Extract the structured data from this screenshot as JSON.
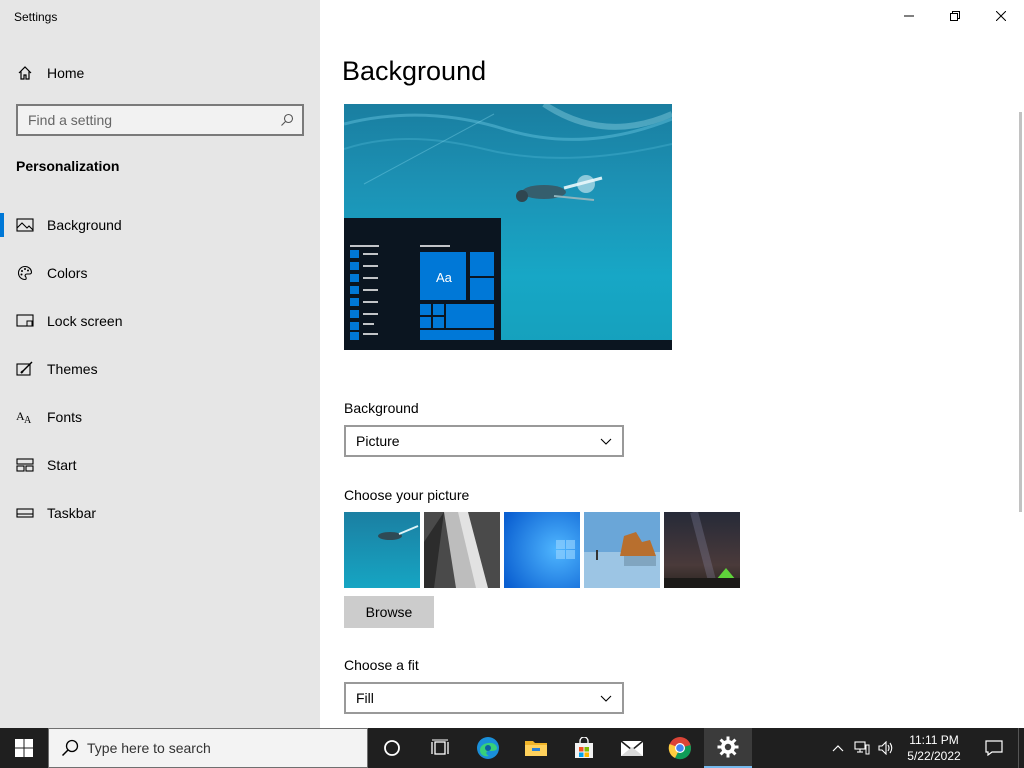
{
  "window": {
    "title": "Settings"
  },
  "sidebar": {
    "home_label": "Home",
    "search_placeholder": "Find a setting",
    "section_title": "Personalization",
    "items": [
      {
        "label": "Background",
        "icon": "picture-icon"
      },
      {
        "label": "Colors",
        "icon": "palette-icon"
      },
      {
        "label": "Lock screen",
        "icon": "lock-screen-icon"
      },
      {
        "label": "Themes",
        "icon": "themes-icon"
      },
      {
        "label": "Fonts",
        "icon": "fonts-icon"
      },
      {
        "label": "Start",
        "icon": "start-icon"
      },
      {
        "label": "Taskbar",
        "icon": "taskbar-icon"
      }
    ],
    "active_item": "Background"
  },
  "main": {
    "page_title": "Background",
    "preview_tile_text": "Aa",
    "background_label": "Background",
    "background_value": "Picture",
    "choose_picture_label": "Choose your picture",
    "browse_label": "Browse",
    "choose_fit_label": "Choose a fit",
    "fit_value": "Fill",
    "thumbnails": [
      "underwater swimmer",
      "grey rock",
      "windows blue",
      "beach rocks",
      "night sky tent"
    ]
  },
  "taskbar": {
    "search_placeholder": "Type here to search",
    "apps": [
      "cortana-icon",
      "task-view-icon",
      "edge-icon",
      "file-explorer-icon",
      "store-icon",
      "mail-icon",
      "chrome-icon",
      "settings-icon"
    ],
    "active_app": "settings-icon",
    "time": "11:11 PM",
    "date": "5/22/2022"
  },
  "colors": {
    "accent": "#0078d7",
    "sidebar_bg": "#e6e6e6",
    "taskbar_bg": "#1f1f1f"
  }
}
